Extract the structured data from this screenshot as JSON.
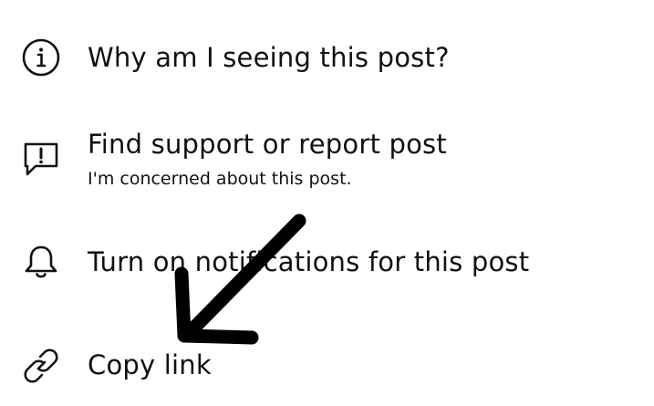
{
  "menu": {
    "items": [
      {
        "label": "Why am I seeing this post?",
        "icon": "info-icon"
      },
      {
        "label": "Find support or report post",
        "sublabel": "I'm concerned about this post.",
        "icon": "report-icon"
      },
      {
        "label": "Turn on notifications for this post",
        "icon": "bell-icon"
      },
      {
        "label": "Copy link",
        "icon": "link-icon"
      }
    ]
  },
  "annotation": {
    "icon": "arrow-annotation",
    "color": "#000000"
  }
}
